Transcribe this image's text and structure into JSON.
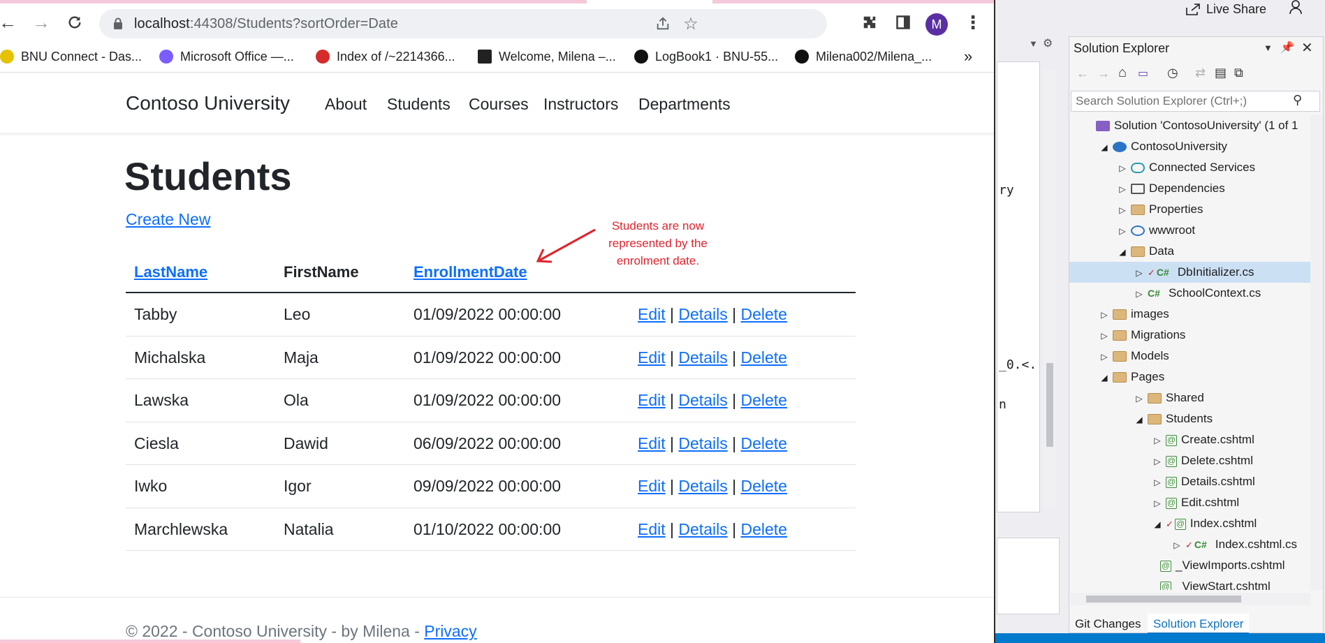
{
  "browser": {
    "url_host": "localhost",
    "url_rest": ":44308/Students?sortOrder=Date",
    "avatar_letter": "M",
    "bookmarks": [
      {
        "label": "BNU Connect - Das...",
        "color": "#e6c200"
      },
      {
        "label": "Microsoft Office —...",
        "color": "#7b5cff"
      },
      {
        "label": "Index of /~2214366...",
        "color": "#d52b2b"
      },
      {
        "label": "Welcome, Milena –...",
        "color": "#222222"
      },
      {
        "label": "LogBook1 · BNU-55...",
        "color": "#111111"
      },
      {
        "label": "Milena002/Milena_...",
        "color": "#111111"
      }
    ],
    "more_label": "»"
  },
  "site": {
    "brand": "Contoso University",
    "nav": [
      "About",
      "Students",
      "Courses",
      "Instructors",
      "Departments"
    ],
    "heading": "Students",
    "create_new": "Create New",
    "columns": [
      "LastName",
      "FirstName",
      "EnrollmentDate"
    ],
    "rows": [
      {
        "last": "Tabby",
        "first": "Leo",
        "date": "01/09/2022 00:00:00"
      },
      {
        "last": "Michalska",
        "first": "Maja",
        "date": "01/09/2022 00:00:00"
      },
      {
        "last": "Lawska",
        "first": "Ola",
        "date": "01/09/2022 00:00:00"
      },
      {
        "last": "Ciesla",
        "first": "Dawid",
        "date": "06/09/2022 00:00:00"
      },
      {
        "last": "Iwko",
        "first": "Igor",
        "date": "09/09/2022 00:00:00"
      },
      {
        "last": "Marchlewska",
        "first": "Natalia",
        "date": "01/10/2022 00:00:00"
      }
    ],
    "actions": {
      "edit": "Edit",
      "details": "Details",
      "delete": "Delete",
      "sep": "|"
    },
    "annotation": "Students are now represented by the enrolment date.",
    "annotation_color": "#e0242d",
    "footer_prefix": "© 2022 - Contoso University - by Milena - ",
    "footer_link": "Privacy"
  },
  "vs": {
    "live_share": "Live Share",
    "code_fragments": [
      "ry",
      "_0.<.",
      "n"
    ],
    "solution_explorer": {
      "title": "Solution Explorer",
      "search_placeholder": "Search Solution Explorer (Ctrl+;)",
      "tree": [
        {
          "label": "Solution 'ContosoUniversity' (1 of 1",
          "type": "solution",
          "expander": ""
        },
        {
          "label": "ContosoUniversity",
          "type": "project",
          "expander": "◢"
        },
        {
          "label": "Connected Services",
          "type": "service",
          "expander": "▷"
        },
        {
          "label": "Dependencies",
          "type": "deps",
          "expander": "▷"
        },
        {
          "label": "Properties",
          "type": "props",
          "expander": "▷"
        },
        {
          "label": "wwwroot",
          "type": "globe",
          "expander": "▷"
        },
        {
          "label": "Data",
          "type": "folder",
          "expander": "◢"
        },
        {
          "label": "DbInitializer.cs",
          "type": "cs",
          "expander": "▷"
        },
        {
          "label": "SchoolContext.cs",
          "type": "cs",
          "expander": "▷"
        },
        {
          "label": "images",
          "type": "folder",
          "expander": "▷"
        },
        {
          "label": "Migrations",
          "type": "folder",
          "expander": "▷"
        },
        {
          "label": "Models",
          "type": "folder",
          "expander": "▷"
        },
        {
          "label": "Pages",
          "type": "folder",
          "expander": "◢"
        },
        {
          "label": "Shared",
          "type": "folder",
          "expander": "▷"
        },
        {
          "label": "Students",
          "type": "folder",
          "expander": "◢"
        },
        {
          "label": "Create.cshtml",
          "type": "razor",
          "expander": "▷"
        },
        {
          "label": "Delete.cshtml",
          "type": "razor",
          "expander": "▷"
        },
        {
          "label": "Details.cshtml",
          "type": "razor",
          "expander": "▷"
        },
        {
          "label": "Edit.cshtml",
          "type": "razor",
          "expander": "▷"
        },
        {
          "label": "Index.cshtml",
          "type": "razor",
          "expander": "◢"
        },
        {
          "label": "Index.cshtml.cs",
          "type": "cs",
          "expander": "▷"
        },
        {
          "label": "_ViewImports.cshtml",
          "type": "razor",
          "expander": ""
        },
        {
          "label": "_ViewStart.cshtml",
          "type": "razor",
          "expander": ""
        }
      ],
      "tabs": [
        "Git Changes",
        "Solution Explorer"
      ]
    }
  }
}
